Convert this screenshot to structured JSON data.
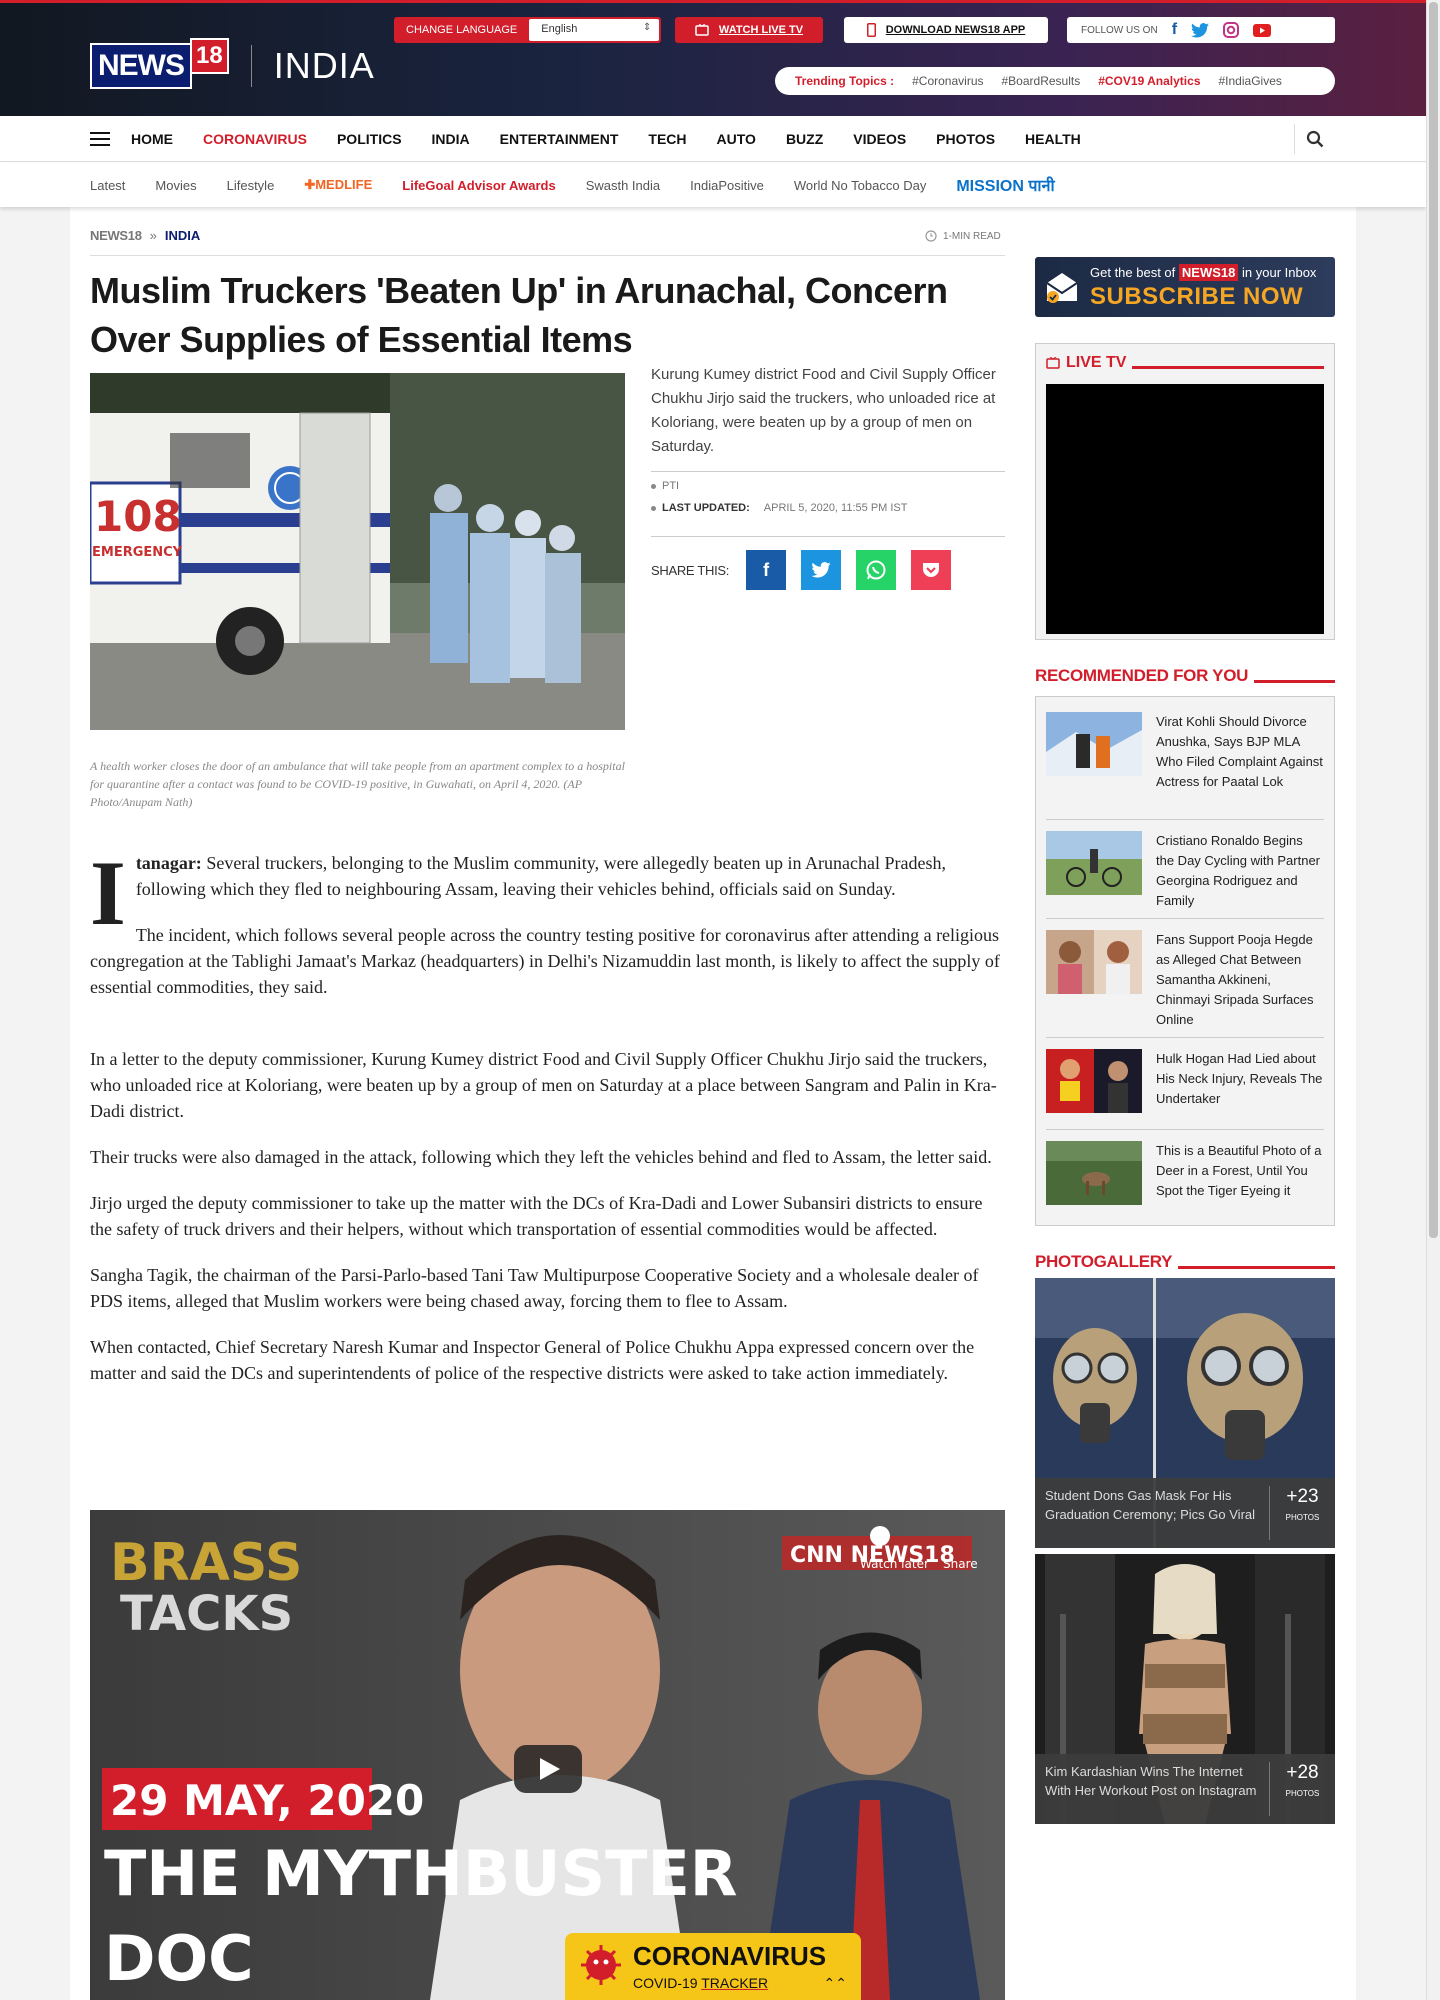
{
  "header": {
    "logo_news": "NEWS",
    "logo_18": "18",
    "edition": "INDIA",
    "change_language_label": "CHANGE LANGUAGE",
    "language_value": "English",
    "watch_live": "WATCH LIVE TV",
    "download_app": "DOWNLOAD NEWS18 APP",
    "follow_label": "FOLLOW US ON",
    "trending_label": "Trending Topics :",
    "trending": [
      "#Coronavirus",
      "#BoardResults",
      "#COV19 Analytics",
      "#IndiaGives"
    ]
  },
  "nav": {
    "items": [
      "HOME",
      "CORONAVIRUS",
      "POLITICS",
      "INDIA",
      "ENTERTAINMENT",
      "TECH",
      "AUTO",
      "BUZZ",
      "VIDEOS",
      "PHOTOS",
      "HEALTH"
    ]
  },
  "subnav": {
    "items": [
      "Latest",
      "Movies",
      "Lifestyle",
      "MEDLIFE",
      "LifeGoal Advisor Awards",
      "Swasth India",
      "IndiaPositive",
      "World No Tobacco Day",
      "MISSION पानी"
    ]
  },
  "article": {
    "breadcrumb_1": "NEWS18",
    "breadcrumb_sep": "»",
    "breadcrumb_2": "INDIA",
    "read_time": "1-MIN READ",
    "title": "Muslim Truckers 'Beaten Up' in Arunachal, Concern Over Supplies of Essential Items",
    "summary": "Kurung Kumey district Food and Civil Supply Officer Chukhu Jirjo said the truckers, who unloaded rice at Koloriang, were beaten up by a group of men on Saturday.",
    "source": "PTI",
    "last_updated_label": "LAST UPDATED:",
    "last_updated": "APRIL 5, 2020, 11:55 PM IST",
    "share_label": "SHARE THIS:",
    "image_caption": "A health worker closes the door of an ambulance that will take people from an apartment complex to a hospital for quarantine after a contact was found to be COVID-19 positive, in Guwahati, on April 4, 2020. (AP Photo/Anupam Nath)",
    "image_ambulance_text": "108",
    "image_emergency_text": "EMERGENCY",
    "dropcap": "I",
    "dateline": "tanagar:",
    "lead": " Several truckers, belonging to the Muslim community, were allegedly beaten up in Arunachal Pradesh, following which they fled to neighbouring Assam, leaving their vehicles behind, officials said on Sunday.",
    "paragraphs": [
      "The incident, which follows several people across the country testing positive for coronavirus after attending a religious congregation at the Tablighi Jamaat's Markaz (headquarters) in Delhi's Nizamuddin last month, is likely to affect the supply of essential commodities, they said.",
      "In a letter to the deputy commissioner, Kurung Kumey district Food and Civil Supply Officer Chukhu Jirjo said the truckers, who unloaded rice at Koloriang, were beaten up by a group of men on Saturday at a place between Sangram and Palin in Kra-Dadi district.",
      "Their trucks were also damaged in the attack, following which they left the vehicles behind and fled to Assam, the letter said.",
      "Jirjo urged the deputy commissioner to take up the matter with the DCs of Kra-Dadi and Lower Subansiri districts to ensure the safety of truck drivers and their helpers, without which transportation of essential commodities would be affected.",
      "Sangha Tagik, the chairman of the Parsi-Parlo-based Tani Taw Multipurpose Cooperative Society and a wholesale dealer of PDS items, alleged that Muslim workers were being chased away, forcing them to flee to Assam.",
      "When contacted, Chief Secretary Naresh Kumar and Inspector General of Police Chukhu Appa expressed concern over the matter and said the DCs and superintendents of police of the respective districts were asked to take action immediately."
    ]
  },
  "video": {
    "brand_1": "BRASS",
    "brand_2": "TACKS",
    "date": "29 MAY, 2020",
    "headline_1": "THE MYTHBUSTER",
    "headline_2": "DOC",
    "channel": "CNN NEWS18",
    "watch_later": "Watch later",
    "share": "Share"
  },
  "sidebar": {
    "subscribe_line1_pre": "Get the best of",
    "subscribe_brand": "NEWS18",
    "subscribe_line1_post": "in your Inbox",
    "subscribe_cta": "SUBSCRIBE NOW",
    "live_tv": "LIVE TV",
    "recommended": "RECOMMENDED FOR YOU",
    "reco_items": [
      "Virat Kohli Should Divorce Anushka, Says BJP MLA Who Filed Complaint Against Actress for Paatal Lok",
      "Cristiano Ronaldo Begins the Day Cycling with Partner Georgina Rodriguez and Family",
      "Fans Support Pooja Hegde as Alleged Chat Between Samantha Akkineni, Chinmayi Sripada Surfaces Online",
      "Hulk Hogan Had Lied about His Neck Injury, Reveals The Undertaker",
      "This is a Beautiful Photo of a Deer in a Forest, Until You Spot the Tiger Eyeing it"
    ],
    "photogallery": "PHOTOGALLERY",
    "galleries": [
      {
        "title": "Student Dons Gas Mask For His Graduation Ceremony; Pics Go Viral",
        "count": "+23",
        "unit": "PHOTOS"
      },
      {
        "title": "Kim Kardashian Wins The Internet With Her Workout Post on Instagram",
        "count": "+28",
        "unit": "PHOTOS"
      }
    ]
  },
  "tracker": {
    "title": "CORONAVIRUS",
    "sub_pre": "COVID-19",
    "sub_link": "TRACKER"
  },
  "colors": {
    "brand_red": "#d21e2b",
    "brand_navy": "#0b1d6e",
    "facebook": "#1a5ba8",
    "twitter": "#1c94e0",
    "whatsapp": "#25d366",
    "pocket": "#ef3f56",
    "tracker_yellow": "#f5c518"
  }
}
